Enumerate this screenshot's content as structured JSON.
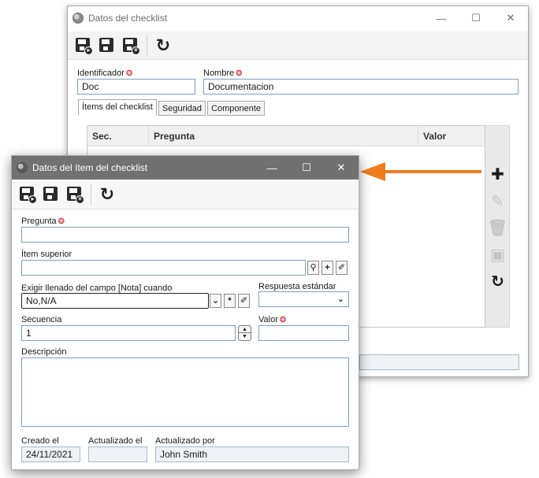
{
  "back_window": {
    "title": "Datos del checklist",
    "toolbar": {
      "save_icon": "save-icon",
      "save_new_icon": "save-new-icon",
      "save_close_icon": "save-close-icon",
      "refresh_icon": "refresh-icon"
    },
    "identificador": {
      "label": "Identificador",
      "value": "Doc"
    },
    "nombre": {
      "label": "Nombre",
      "value": "Documentacion"
    },
    "tabs": [
      "Ítems del checklist",
      "Seguridad",
      "Componente"
    ],
    "grid_columns": [
      "Sec.",
      "Pregunta",
      "Valor"
    ],
    "side_buttons": [
      "add-icon",
      "edit-icon",
      "delete-icon",
      "view-icon",
      "refresh-icon"
    ]
  },
  "front_window": {
    "title": "Datos del ítem del checklist",
    "pregunta": {
      "label": "Pregunta",
      "value": ""
    },
    "item_superior": {
      "label": "Ítem superior",
      "value": ""
    },
    "exigir": {
      "label": "Exigir llenado del campo [Nota] cuando",
      "value": "No,N/A"
    },
    "respuesta": {
      "label": "Respuesta estándar",
      "value": ""
    },
    "secuencia": {
      "label": "Secuencia",
      "value": "1"
    },
    "valor": {
      "label": "Valor",
      "value": ""
    },
    "descripcion": {
      "label": "Descripción",
      "value": ""
    },
    "creado": {
      "label": "Creado el",
      "value": "24/11/2021"
    },
    "actualizado": {
      "label": "Actualizado el",
      "value": ""
    },
    "actualizado_por": {
      "label": "Actualizado por",
      "value": "John Smith"
    }
  },
  "colors": {
    "arrow": "#f07d1a",
    "front_titlebar": "#717171",
    "required": "#d01c1c",
    "field_border": "#7a9fc4"
  }
}
